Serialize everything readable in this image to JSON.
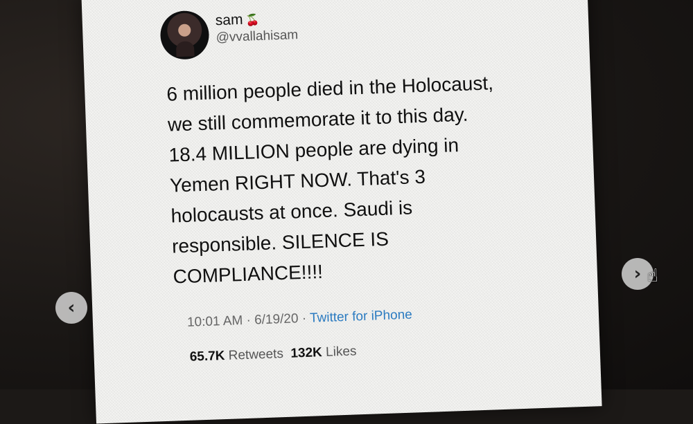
{
  "tweet": {
    "display_name": "sam",
    "emoji": "🍒",
    "handle": "@vvallahisam",
    "text_lines": [
      "6 million people died in the Holocaust,",
      "we still commemorate it to this day.",
      "18.4 MILLION people are dying in",
      "Yemen RIGHT NOW. That's 3",
      "holocausts at once. Saudi is",
      "responsible. SILENCE IS",
      "COMPLIANCE!!!!"
    ],
    "timestamp": "10:01 AM · 6/19/20 ·",
    "source": "Twitter for iPhone",
    "retweets_count": "65.7K",
    "retweets_label": "Retweets",
    "likes_count": "132K",
    "likes_label": "Likes"
  },
  "nav": {
    "prev_icon": "chevron-left-icon",
    "next_icon": "chevron-right-icon",
    "prev_glyph": "‹",
    "next_glyph": "›"
  },
  "colors": {
    "link": "#2b7bc1",
    "card": "#f3f3f1",
    "background": "#1c1917"
  }
}
